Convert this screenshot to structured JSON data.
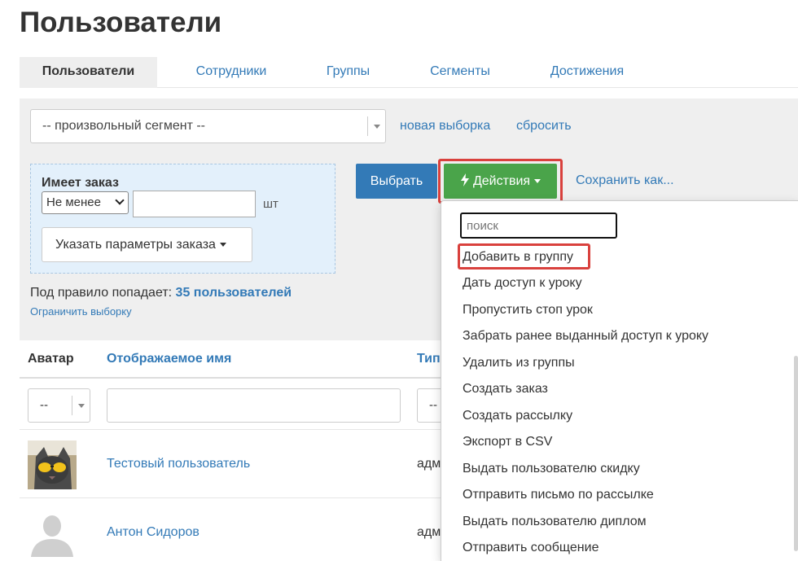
{
  "page_title": "Пользователи",
  "tabs": [
    {
      "label": "Пользователи",
      "active": true
    },
    {
      "label": "Сотрудники",
      "active": false
    },
    {
      "label": "Группы",
      "active": false
    },
    {
      "label": "Сегменты",
      "active": false
    },
    {
      "label": "Достижения",
      "active": false
    }
  ],
  "filter": {
    "segment_value": "-- произвольный сегмент --",
    "new_selection_label": "новая выборка",
    "reset_label": "сбросить",
    "condition": {
      "title": "Имеет заказ",
      "comparator": "Не менее",
      "quantity": "",
      "unit": "шт",
      "params_button": "Указать параметры заказа"
    },
    "rule_prefix": "Под правило попадает:",
    "rule_count": "35 пользователей",
    "limit_link": "Ограничить выборку",
    "select_button": "Выбрать",
    "actions_button": "Действия",
    "save_as_label": "Сохранить как..."
  },
  "actions_menu": {
    "search_placeholder": "поиск",
    "items": [
      "Добавить в группу",
      "Дать доступ к уроку",
      "Пропустить стоп урок",
      "Забрать ранее выданный доступ к уроку",
      "Удалить из группы",
      "Создать заказ",
      "Создать рассылку",
      "Экспорт в CSV",
      "Выдать пользователю скидку",
      "Отправить письмо по рассылке",
      "Выдать пользователю диплом",
      "Отправить сообщение"
    ],
    "highlighted_item": "Добавить в группу"
  },
  "table": {
    "headers": {
      "avatar": "Аватар",
      "display_name": "Отображаемое имя",
      "type": "Тип"
    },
    "filters": {
      "avatar_select": "--",
      "type_select": "--"
    },
    "rows": [
      {
        "name": "Тестовый пользователь",
        "type": "адм",
        "avatar": "cat-photo"
      },
      {
        "name": "Антон Сидоров",
        "type": "адм",
        "avatar": "default-silhouette"
      }
    ]
  },
  "colors": {
    "link": "#337ab7",
    "primary_button": "#337ab7",
    "actions_button": "#4aa44a",
    "highlight_border": "#d9413d",
    "condition_box": "#e3f0fb",
    "panel_bg": "#efefef"
  }
}
